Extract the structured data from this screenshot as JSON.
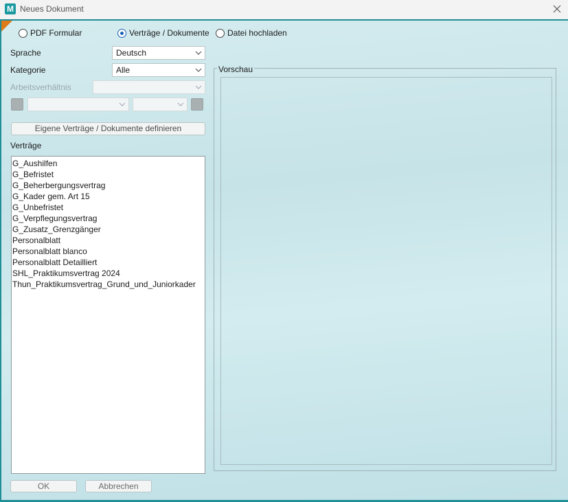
{
  "window": {
    "app_icon_letter": "M",
    "title": "Neues Dokument"
  },
  "mode_radios": [
    {
      "label": "PDF Formular",
      "selected": false
    },
    {
      "label": "Verträge / Dokumente",
      "selected": true
    },
    {
      "label": "Datei hochladen",
      "selected": false
    }
  ],
  "form": {
    "sprache_label": "Sprache",
    "sprache_value": "Deutsch",
    "kategorie_label": "Kategorie",
    "kategorie_value": "Alle",
    "arbeitsverhaeltnis_label": "Arbeitsverhältnis",
    "arbeitsverhaeltnis_value": "",
    "filter1_value": "",
    "filter2_value": ""
  },
  "define_button_label": "Eigene Verträge / Dokumente definieren",
  "list": {
    "label": "Verträge",
    "items": [
      "G_Aushilfen",
      "G_Befristet",
      "G_Beherbergungsvertrag",
      "G_Kader gem. Art 15",
      "G_Unbefristet",
      "G_Verpflegungsvertrag",
      "G_Zusatz_Grenzgänger",
      "Personalblatt",
      "Personalblatt blanco",
      "Personalblatt Detailliert",
      "SHL_Praktikumsvertrag 2024",
      "Thun_Praktikumsvertrag_Grund_und_Juniorkader"
    ]
  },
  "preview": {
    "title": "Vorschau"
  },
  "buttons": {
    "ok": "OK",
    "cancel": "Abbrechen"
  },
  "colors": {
    "accent": "#1f8e96",
    "radio_selected": "#1a5fb4",
    "corner_flag": "#e07b1a"
  }
}
